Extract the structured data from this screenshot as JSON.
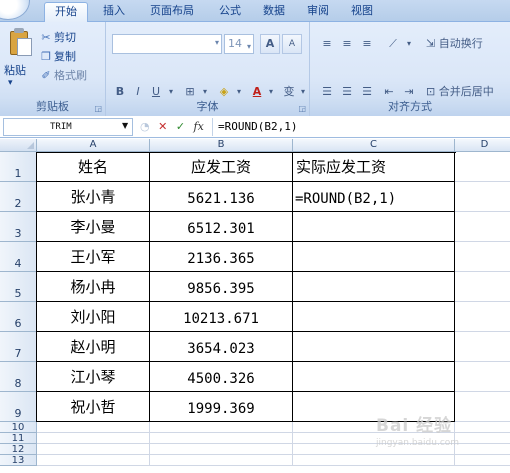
{
  "ribbon": {
    "tabs": [
      "开始",
      "插入",
      "页面布局",
      "公式",
      "数据",
      "审阅",
      "视图"
    ],
    "clipboard": {
      "paste": "粘贴",
      "cut": "剪切",
      "copy": "复制",
      "format_painter": "格式刷",
      "group_label": "剪贴板"
    },
    "font": {
      "size": "14",
      "grow": "A",
      "shrink": "A",
      "bold": "B",
      "italic": "I",
      "underline": "U",
      "phonetic": "变",
      "group_label": "字体"
    },
    "alignment": {
      "wrap_text": "自动换行",
      "merge_center": "合并后居中",
      "group_label": "对齐方式"
    }
  },
  "formula_bar": {
    "name_box": "TRIM",
    "cancel": "✕",
    "enter": "✓",
    "fx": "fx",
    "formula": "=ROUND(B2,1)"
  },
  "sheet": {
    "columns": [
      "A",
      "B",
      "C",
      "D"
    ],
    "row_numbers": [
      "1",
      "2",
      "3",
      "4",
      "5",
      "6",
      "7",
      "8",
      "9",
      "10",
      "11",
      "12",
      "13"
    ],
    "header": [
      "姓名",
      "应发工资",
      "实际应发工资"
    ],
    "rows": [
      {
        "name": "张小青",
        "salary": "5621.136",
        "actual": "=ROUND(B2,1)"
      },
      {
        "name": "李小曼",
        "salary": "6512.301",
        "actual": ""
      },
      {
        "name": "王小军",
        "salary": "2136.365",
        "actual": ""
      },
      {
        "name": "杨小冉",
        "salary": "9856.395",
        "actual": ""
      },
      {
        "name": "刘小阳",
        "salary": "10213.671",
        "actual": ""
      },
      {
        "name": "赵小明",
        "salary": "3654.023",
        "actual": ""
      },
      {
        "name": "江小琴",
        "salary": "4500.326",
        "actual": ""
      },
      {
        "name": "祝小哲",
        "salary": "1999.369",
        "actual": ""
      }
    ]
  },
  "watermark": {
    "text": "Bai 经验",
    "sub": "jingyan.baidu.com"
  }
}
